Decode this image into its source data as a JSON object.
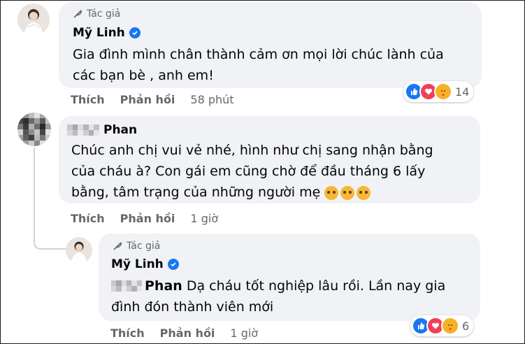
{
  "comments": [
    {
      "author_badge": "Tác giả",
      "name": "Mỹ Linh",
      "text_line1": "Gia đình mình chân thành cảm ơn mọi lời chúc lành của",
      "text_line2": "các bạn bè , anh em!",
      "actions": {
        "like": "Thích",
        "reply": "Phản hồi",
        "time": "58 phút"
      },
      "reaction_count": "14"
    },
    {
      "name": "Phan",
      "text_line1": "Chúc anh chị vui vẻ nhé, hình như chị sang nhận bằng",
      "text_line2": "của cháu à? Con gái em cũng chờ để đầu tháng 6 lấy",
      "text_line3": "bằng, tâm trạng của những người mẹ",
      "actions": {
        "like": "Thích",
        "reply": "Phản hồi",
        "time": "1 giờ"
      }
    },
    {
      "author_badge": "Tác giả",
      "name": "Mỹ Linh",
      "mention": "Phan",
      "text_line1": " Dạ cháu tốt nghiệp lâu rồi. Lần nay gia",
      "text_line2": "đình đón thành viên mới",
      "actions": {
        "like": "Thích",
        "reply": "Phản hồi",
        "time": "1 giờ"
      },
      "reaction_count": "6"
    }
  ],
  "colors": {
    "like": "#1877f2",
    "love": "#f33e58",
    "care": "#f7b125",
    "bubble": "#f0f2f5",
    "muted": "#65676b"
  }
}
